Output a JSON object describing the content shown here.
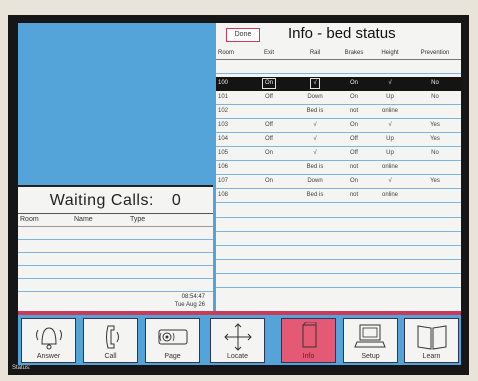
{
  "waiting_calls": {
    "title": "Waiting Calls:",
    "count": "0",
    "columns": [
      "Room",
      "Name",
      "Type"
    ],
    "time": "08:54:47",
    "date": "Tue Aug 26"
  },
  "info": {
    "done_label": "Done",
    "title": "Info - bed status",
    "columns": [
      "Room",
      "Exit",
      "Rail",
      "Brakes",
      "Height",
      "Prevention"
    ],
    "rows": [
      {
        "room": "100",
        "exit": "On",
        "rail": "√",
        "brakes": "On",
        "height": "√",
        "prevention": "No"
      },
      {
        "room": "101",
        "exit": "Off",
        "rail": "Down",
        "brakes": "On",
        "height": "Up",
        "prevention": "No"
      },
      {
        "room": "102",
        "exit": "",
        "rail": "Bed is",
        "brakes": "not",
        "height": "online",
        "prevention": ""
      },
      {
        "room": "103",
        "exit": "Off",
        "rail": "√",
        "brakes": "On",
        "height": "√",
        "prevention": "Yes"
      },
      {
        "room": "104",
        "exit": "Off",
        "rail": "√",
        "brakes": "Off",
        "height": "Up",
        "prevention": "Yes"
      },
      {
        "room": "105",
        "exit": "On",
        "rail": "√",
        "brakes": "Off",
        "height": "Up",
        "prevention": "No"
      },
      {
        "room": "106",
        "exit": "",
        "rail": "Bed is",
        "brakes": "not",
        "height": "online",
        "prevention": ""
      },
      {
        "room": "107",
        "exit": "On",
        "rail": "Down",
        "brakes": "On",
        "height": "√",
        "prevention": "Yes"
      },
      {
        "room": "108",
        "exit": "",
        "rail": "Bed is",
        "brakes": "not",
        "height": "online",
        "prevention": ""
      }
    ]
  },
  "toolbar": {
    "answer": "Answer",
    "call": "Call",
    "page": "Page",
    "locate": "Locate",
    "info": "Info",
    "setup": "Setup",
    "learn": "Learn"
  },
  "status_label": "Status:",
  "colors": {
    "screen_blue": "#55a4d9",
    "accent_pink": "#e45a74",
    "panel": "#f4f4f2"
  }
}
